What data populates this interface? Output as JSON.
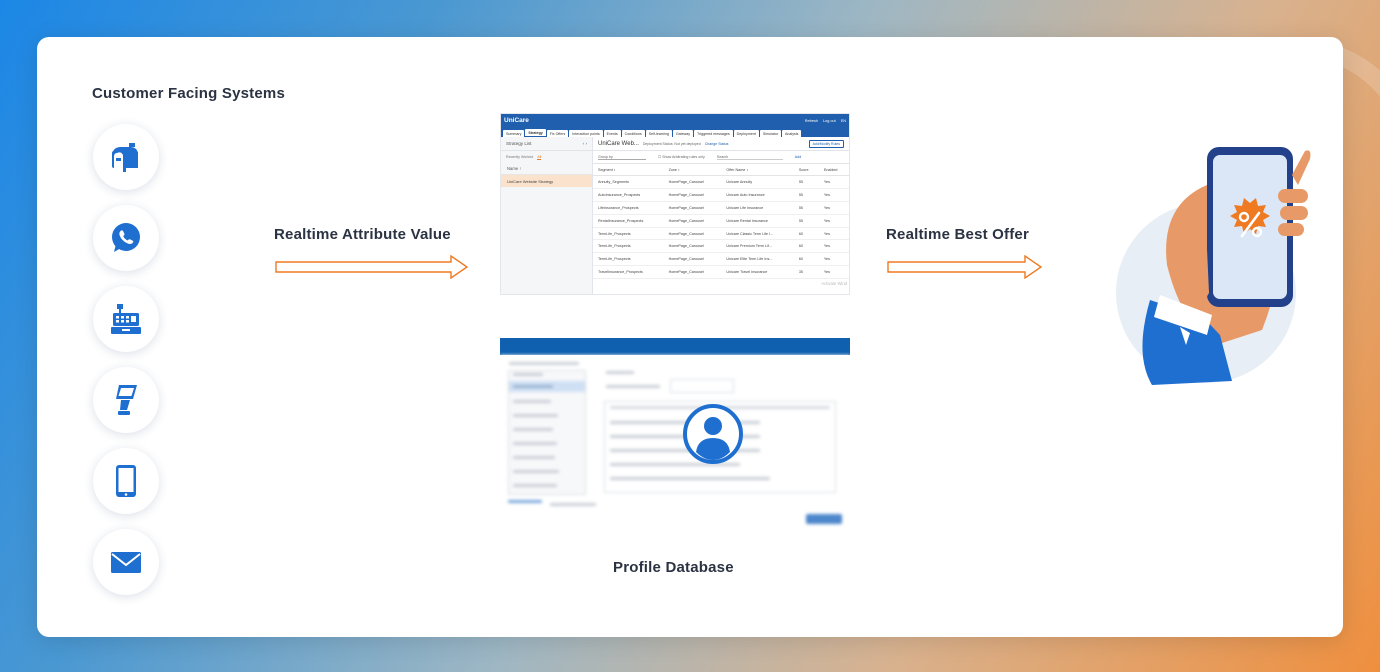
{
  "labels": {
    "customer_facing": "Customer Facing Systems",
    "realtime_attribute": "Realtime Attribute Value",
    "realtime_offer": "Realtime Best Offer",
    "profile_database": "Profile Database"
  },
  "channel_icons": [
    "mailbox-icon",
    "whatsapp-icon",
    "cash-register-icon",
    "kiosk-icon",
    "mobile-phone-icon",
    "email-icon"
  ],
  "strategy_app": {
    "logo": "UniCare",
    "top_links": [
      "Refresh",
      "Log out",
      "EN"
    ],
    "tabs": [
      "Summary",
      "Strategy",
      "Fix Offers",
      "Interaction points",
      "Events",
      "Conditions",
      "Self-learning",
      "Gateway",
      "Triggered messages",
      "Deployment",
      "Simulator",
      "Analysis"
    ],
    "active_tab": "Strategy",
    "left_title": "Strategy List",
    "left_filters": [
      "Recently Worked",
      "All"
    ],
    "left_name_header": "Name",
    "left_selected": "UniCare Website Strategy",
    "panel_title": "UniCare Web...",
    "panel_status": "Deployment Status: Not yet deployed",
    "change_status": "Change Status",
    "add_button": "Add/Modify Rules",
    "group_by": "Group by",
    "show_attr": "Show Arbitrating rules only",
    "search": "Search",
    "add_link": "Add",
    "columns": [
      "Segment",
      "Zone",
      "Offer Name",
      "Score",
      "Enabled"
    ],
    "rows": [
      [
        "Annuity_Segments",
        "HomePage_Carousel",
        "Unicare Annuity",
        "55",
        "Yes"
      ],
      [
        "AutoInsurance_Prospects",
        "HomePage_Carousel",
        "Unicare Auto Insurance",
        "55",
        "Yes"
      ],
      [
        "LifeInsurance_Prospects",
        "HomePage_Carousel",
        "Unicare Life Insurance",
        "55",
        "Yes"
      ],
      [
        "RentalInsurance_Prospects",
        "HomePage_Carousel",
        "Unicare Rental Insurance",
        "55",
        "Yes"
      ],
      [
        "TermLife_Prospects",
        "HomePage_Carousel",
        "Unicare Classic Term Life I...",
        "60",
        "Yes"
      ],
      [
        "TermLife_Prospects",
        "HomePage_Carousel",
        "Unicare Premium Term Lif...",
        "60",
        "Yes"
      ],
      [
        "TermLife_Prospects",
        "HomePage_Carousel",
        "Unicare Elite Term Life Ins...",
        "60",
        "Yes"
      ],
      [
        "TravelInsurance_Prospects",
        "HomePage_Carousel",
        "Unicare Travel Insurance",
        "35",
        "Yes"
      ]
    ],
    "watermark": "Activate Wind"
  },
  "colors": {
    "arrow": "#f07a22",
    "brand_blue": "#1f6fd0",
    "title_text": "#2b3343",
    "offer_badge": "#f07a22"
  }
}
